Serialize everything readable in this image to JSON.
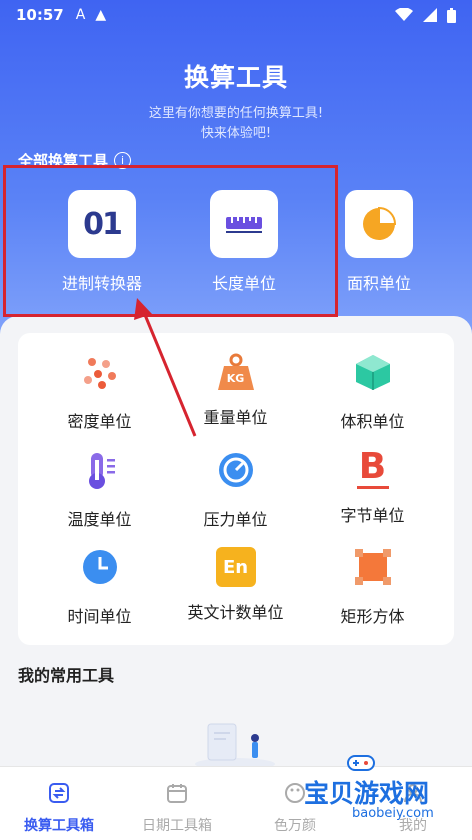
{
  "status": {
    "time": "10:57",
    "glyph_a": "A",
    "glyph_b": "▲"
  },
  "header": {
    "title": "换算工具",
    "subtitle_line1": "这里有你想要的任何换算工具!",
    "subtitle_line2": "快来体验吧!",
    "section_label": "全部换算工具",
    "info_glyph": "i"
  },
  "featured": [
    {
      "label": "进制转换器",
      "icon": "binary-01-icon",
      "icon_text": "01"
    },
    {
      "label": "长度单位",
      "icon": "ruler-icon"
    },
    {
      "label": "面积单位",
      "icon": "pie-chart-icon"
    }
  ],
  "tools": [
    {
      "label": "密度单位",
      "icon": "density-dots-icon"
    },
    {
      "label": "重量单位",
      "icon": "weight-kg-icon",
      "icon_text": "KG"
    },
    {
      "label": "体积单位",
      "icon": "cube-icon"
    },
    {
      "label": "温度单位",
      "icon": "thermometer-icon"
    },
    {
      "label": "压力单位",
      "icon": "gauge-icon"
    },
    {
      "label": "字节单位",
      "icon": "byte-b-icon",
      "icon_text": "B"
    },
    {
      "label": "时间单位",
      "icon": "clock-icon"
    },
    {
      "label": "英文计数单位",
      "icon": "en-icon",
      "icon_text": "En"
    },
    {
      "label": "矩形方体",
      "icon": "rectangle-icon"
    }
  ],
  "common": {
    "title": "我的常用工具"
  },
  "nav": [
    {
      "label": "换算工具箱",
      "icon": "convert-icon",
      "active": true
    },
    {
      "label": "日期工具箱",
      "icon": "calendar-icon",
      "active": false
    },
    {
      "label": "色万颜",
      "icon": "palette-icon",
      "active": false
    },
    {
      "label": "我的",
      "icon": "user-icon",
      "active": false
    }
  ],
  "watermark": {
    "text": "宝贝游戏网",
    "sub": "baobeiy.com"
  },
  "colors": {
    "accent": "#3a5cf0",
    "highlight": "#d6242f",
    "hero_top": "#3f64f2"
  }
}
